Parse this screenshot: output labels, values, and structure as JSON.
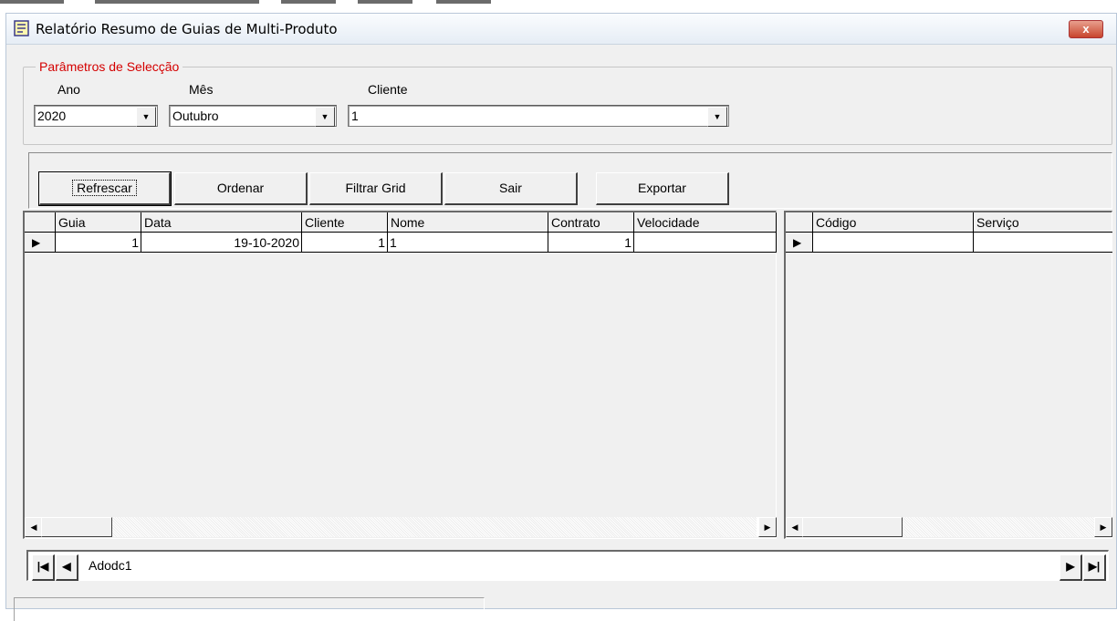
{
  "window": {
    "title": "Relatório Resumo de Guias de Multi-Produto",
    "close_symbol": "x"
  },
  "params": {
    "legend": "Parâmetros de Selecção",
    "ano": {
      "label": "Ano",
      "value": "2020"
    },
    "mes": {
      "label": "Mês",
      "value": "Outubro"
    },
    "cliente": {
      "label": "Cliente",
      "value": "1"
    }
  },
  "toolbar": {
    "refrescar": "Refrescar",
    "ordenar": "Ordenar",
    "filtrar": "Filtrar Grid",
    "sair": "Sair",
    "exportar": "Exportar"
  },
  "grid_main": {
    "columns": [
      "Guia",
      "Data",
      "Cliente",
      "Nome",
      "Contrato",
      "Velocidade"
    ],
    "rows": [
      {
        "guia": "1",
        "data": "19-10-2020",
        "cliente": "1",
        "nome": "1",
        "contrato": "1",
        "velocidade": ""
      }
    ]
  },
  "grid_right": {
    "columns": [
      "Código",
      "Serviço"
    ],
    "rows": [
      {
        "codigo": "",
        "servico": ""
      }
    ]
  },
  "adodc": {
    "caption": "Adodc1"
  },
  "icons": {
    "row_indicator": "▶",
    "scroll_left": "◀",
    "scroll_right": "▶",
    "combo_arrow": "▼",
    "nav_first": "|◀",
    "nav_prev": "◀",
    "nav_next": "▶",
    "nav_last": "▶|"
  }
}
